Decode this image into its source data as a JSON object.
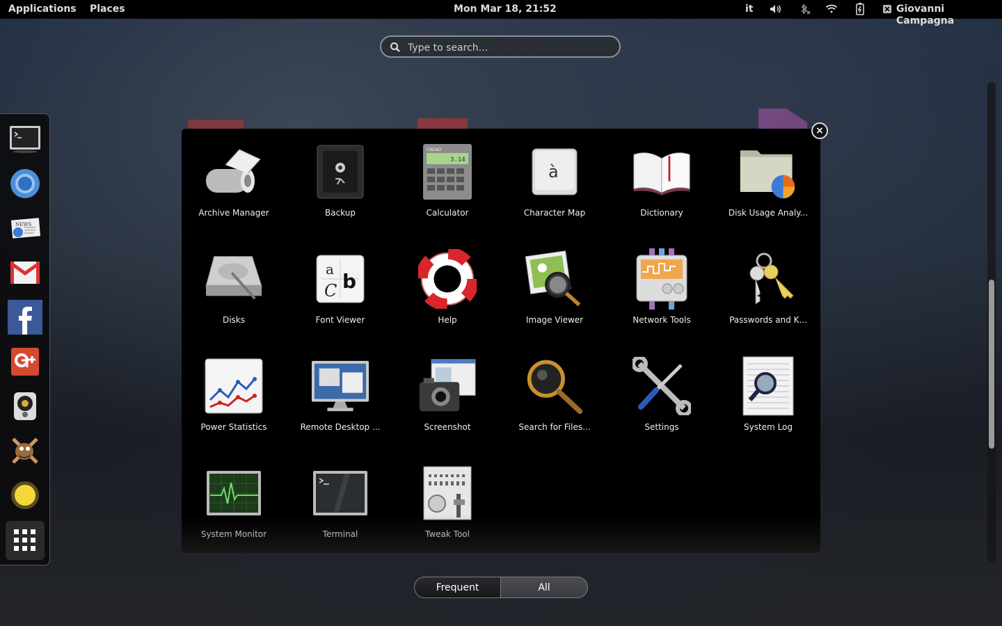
{
  "topbar": {
    "applications": "Applications",
    "places": "Places",
    "clock": "Mon Mar 18, 21:52",
    "keyboard_layout": "it",
    "user_name": "Giovanni Campagna"
  },
  "search": {
    "placeholder": "Type to search..."
  },
  "dash": {
    "items": [
      {
        "name": "terminal"
      },
      {
        "name": "chromium"
      },
      {
        "name": "news"
      },
      {
        "name": "gmail"
      },
      {
        "name": "facebook"
      },
      {
        "name": "google-plus"
      },
      {
        "name": "speaker"
      },
      {
        "name": "gimp"
      },
      {
        "name": "weather"
      },
      {
        "name": "show-applications"
      }
    ]
  },
  "apps": [
    {
      "label": "Archive Manager"
    },
    {
      "label": "Backup"
    },
    {
      "label": "Calculator"
    },
    {
      "label": "Character Map"
    },
    {
      "label": "Dictionary"
    },
    {
      "label": "Disk Usage Analy..."
    },
    {
      "label": "Disks"
    },
    {
      "label": "Font Viewer"
    },
    {
      "label": "Help"
    },
    {
      "label": "Image Viewer"
    },
    {
      "label": "Network Tools"
    },
    {
      "label": "Passwords and K..."
    },
    {
      "label": "Power Statistics"
    },
    {
      "label": "Remote Desktop ..."
    },
    {
      "label": "Screenshot"
    },
    {
      "label": "Search for Files..."
    },
    {
      "label": "Settings"
    },
    {
      "label": "System Log"
    },
    {
      "label": "System Monitor"
    },
    {
      "label": "Terminal"
    },
    {
      "label": "Tweak Tool"
    }
  ],
  "icon_texts": {
    "character_map": "à",
    "font_viewer_a": "a",
    "font_viewer_b": "b",
    "font_viewer_c": "C",
    "calculator_brand": "CACAO",
    "calculator_display": "3.14",
    "news": "NEWS"
  },
  "view_switch": {
    "frequent": "Frequent",
    "all": "All"
  },
  "close_glyph": "×"
}
